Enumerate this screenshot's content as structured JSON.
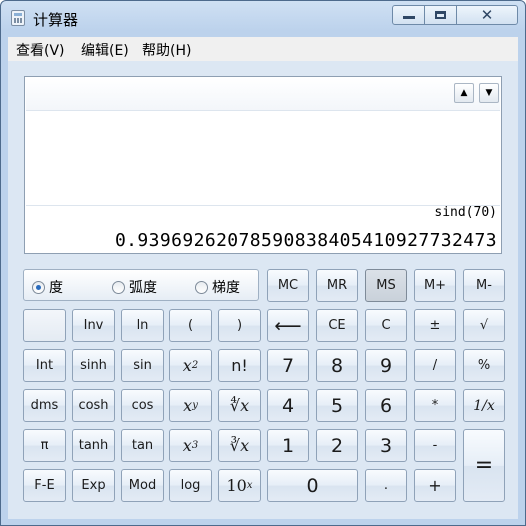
{
  "window": {
    "title": "计算器"
  },
  "menu": {
    "view": "查看(V)",
    "edit": "编辑(E)",
    "help": "帮助(H)"
  },
  "display": {
    "expression": "sind(70)",
    "result": "0.93969262078590838405410927732473"
  },
  "angle_mode": {
    "options": [
      "度",
      "弧度",
      "梯度"
    ],
    "selected": "度"
  },
  "memory": [
    "MC",
    "MR",
    "MS",
    "M+",
    "M-"
  ],
  "buttons": {
    "inv": "Inv",
    "ln": "ln",
    "lparen": "(",
    "rparen": ")",
    "backspace": "⟵",
    "ce": "CE",
    "c": "C",
    "plusminus": "±",
    "sqrt": "√",
    "int": "Int",
    "sinh": "sinh",
    "sin": "sin",
    "x2_base": "x",
    "x2_exp": "2",
    "fact": "n!",
    "d7": "7",
    "d8": "8",
    "d9": "9",
    "div": "/",
    "pct": "%",
    "dms": "dms",
    "cosh": "cosh",
    "cos": "cos",
    "xy_base": "x",
    "xy_exp": "y",
    "yroot": "∜x",
    "d4": "4",
    "d5": "5",
    "d6": "6",
    "mul": "*",
    "recip": "1/x",
    "pi": "π",
    "tanh": "tanh",
    "tan": "tan",
    "x3_base": "x",
    "x3_exp": "3",
    "cbrt": "∛x",
    "d1": "1",
    "d2": "2",
    "d3": "3",
    "sub": "-",
    "eq": "=",
    "fe": "F-E",
    "exp": "Exp",
    "mod": "Mod",
    "log": "log",
    "tenx_base": "10",
    "tenx_exp": "x",
    "d0": "0",
    "dot": ".",
    "add": "+"
  }
}
